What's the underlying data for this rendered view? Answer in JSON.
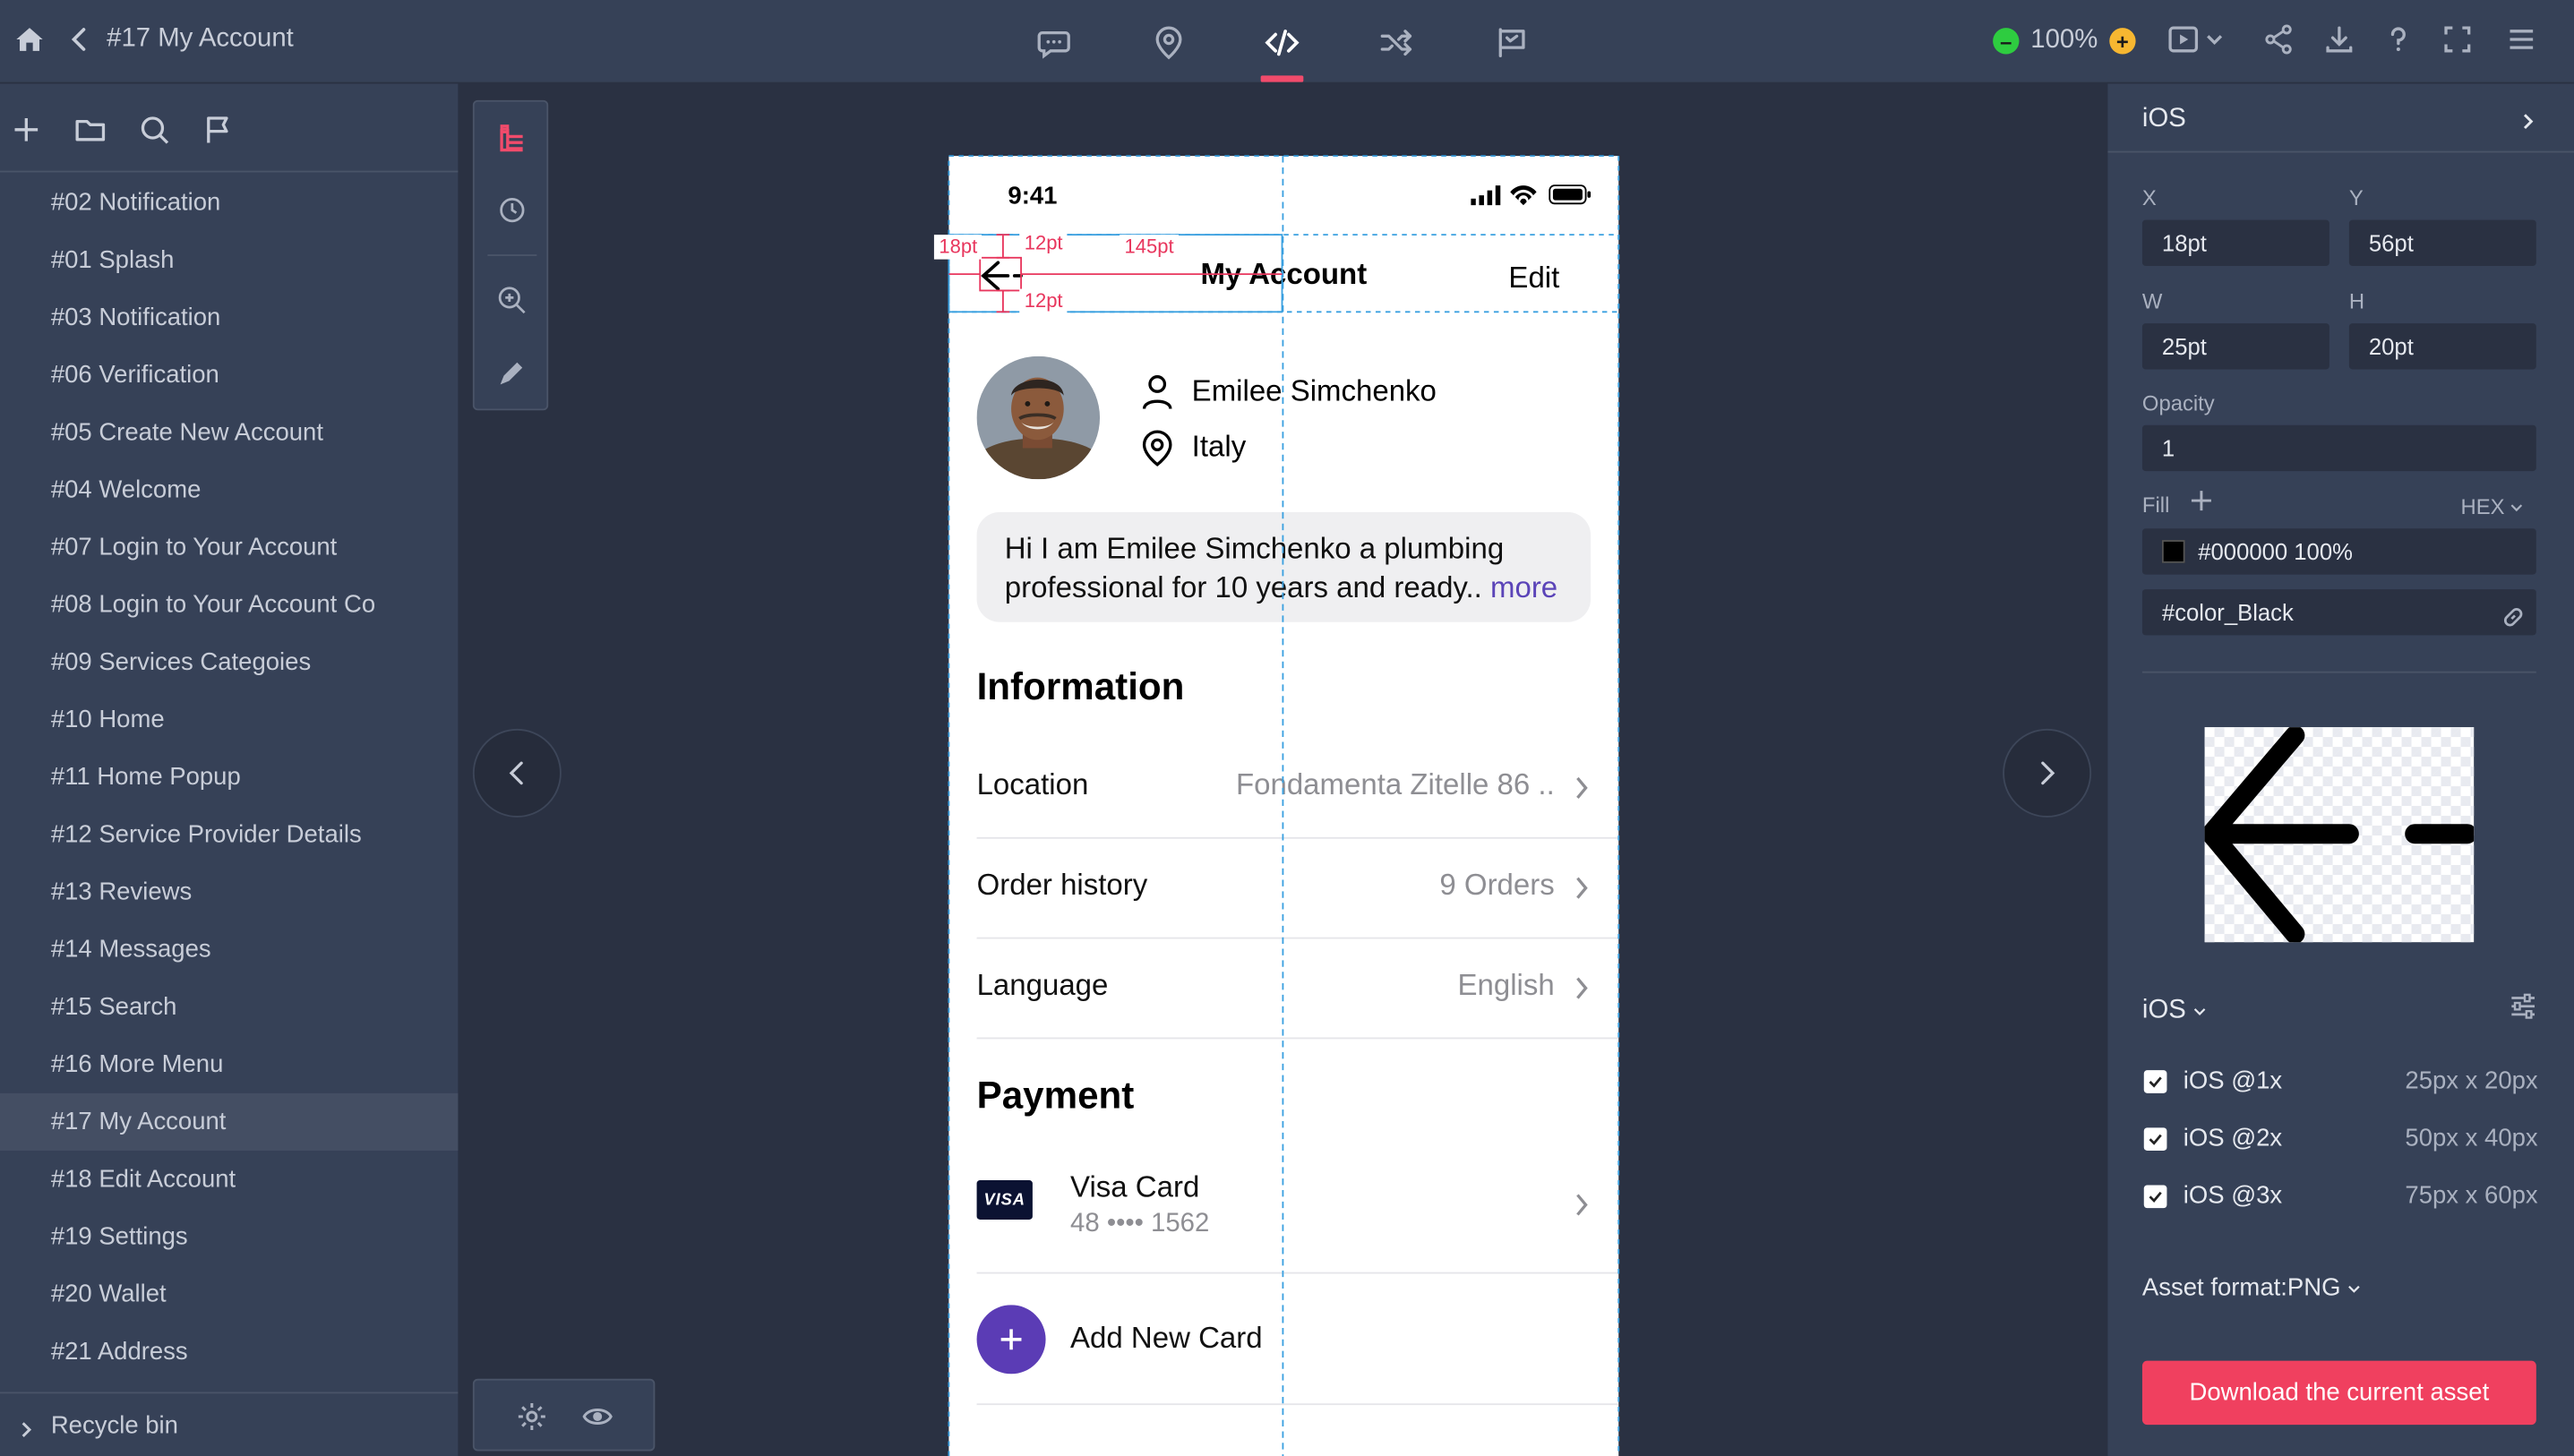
{
  "header": {
    "breadcrumb": "#17 My Account",
    "zoom": "100%",
    "nav_icons": [
      "comment-icon",
      "location-pin-icon",
      "code-icon",
      "shuffle-icon",
      "flag-board-icon"
    ],
    "accent_color": "#f14b6b"
  },
  "sidebar": {
    "screens": [
      "#02 Notification",
      "#01 Splash",
      "#03 Notification",
      "#06 Verification",
      "#05 Create New Account",
      "#04 Welcome",
      "#07 Login to Your Account",
      "#08 Login to Your Account Co",
      "#09 Services Categoies",
      "#10 Home",
      "#11 Home Popup",
      "#12 Service Provider Details",
      "#13 Reviews",
      "#14 Messages",
      "#15 Search",
      "#16 More Menu",
      "#17 My Account",
      "#18 Edit Account",
      "#19 Settings",
      "#20 Wallet",
      "#21 Address"
    ],
    "active_screen": "#17 My Account",
    "recycle_bin": "Recycle bin"
  },
  "phone": {
    "status_time": "9:41",
    "nav_title": "My Account",
    "nav_edit": "Edit",
    "profile": {
      "name": "Emilee Simchenko",
      "location": "Italy",
      "bio": "Hi I am Emilee Simchenko a plumbing professional for 10 years and ready.. ",
      "bio_more": "more"
    },
    "information": {
      "title": "Information",
      "rows": [
        {
          "label": "Location",
          "value": "Fondamenta Zitelle 86 .."
        },
        {
          "label": "Order history",
          "value": "9 Orders"
        },
        {
          "label": "Language",
          "value": "English"
        }
      ]
    },
    "payment": {
      "title": "Payment",
      "card_brand": "VISA",
      "card_title": "Visa Card",
      "card_number": "48 •••• 1562",
      "add_card": "Add New Card",
      "add_color": "#5b3cb5"
    }
  },
  "measurements": {
    "left": "18pt",
    "top": "12pt",
    "right": "145pt",
    "bottom": "12pt"
  },
  "inspector": {
    "platform_header": "iOS",
    "x_label": "X",
    "x_value": "18pt",
    "y_label": "Y",
    "y_value": "56pt",
    "w_label": "W",
    "w_value": "25pt",
    "h_label": "H",
    "h_value": "20pt",
    "opacity_label": "Opacity",
    "opacity_value": "1",
    "fill_label": "Fill",
    "fill_mode": "HEX",
    "fill_value": "#000000 100%",
    "color_token": "#color_Black",
    "export_platform": "iOS",
    "exports": [
      {
        "name": "iOS @1x",
        "size": "25px x 20px"
      },
      {
        "name": "iOS @2x",
        "size": "50px x 40px"
      },
      {
        "name": "iOS @3x",
        "size": "75px x 60px"
      }
    ],
    "asset_format_label": "Asset format:",
    "asset_format_value": "PNG",
    "download_label": "Download the current asset",
    "download_color": "#f0405f"
  }
}
